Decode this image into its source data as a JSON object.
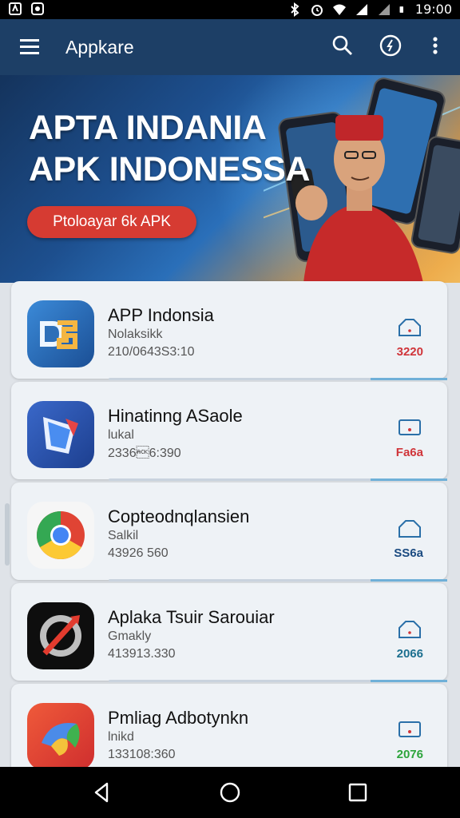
{
  "status_bar": {
    "time": "19:00",
    "icons": [
      "notification-icon",
      "camera-icon",
      "bluetooth-icon",
      "alarm-icon",
      "wifi-icon",
      "signal-icon",
      "signal-icon",
      "battery-icon"
    ]
  },
  "app_bar": {
    "title": "Appkare",
    "icons": [
      "menu-icon",
      "search-icon",
      "history-icon",
      "more-vert-icon"
    ]
  },
  "banner": {
    "headline_1": "APTA INDANIA",
    "headline_2": "APK INDONESSA",
    "cta_label": "Ptoloayar 6k APK"
  },
  "apps": [
    {
      "name": "APP Indonsia",
      "subtitle": "Nolaksikk",
      "meta": "210/0643S3:10",
      "count": "3220",
      "count_color": "#d0353a",
      "icon": "app-indonsia-icon"
    },
    {
      "name": "Hinatinng ASaole",
      "subtitle": "lukal",
      "meta": "2336\u00066:390",
      "count": "Fa6a",
      "count_color": "#d0353a",
      "icon": "hinatinng-asaole-icon"
    },
    {
      "name": "Copteodnqlansien",
      "subtitle": "Salkil",
      "meta": "43926 560",
      "count": "SS6a",
      "count_color": "#1a4a80",
      "icon": "chrome-icon"
    },
    {
      "name": "Aplaka Tsuir Sarouiar",
      "subtitle": "Gmakly",
      "meta": "413913.330",
      "count": "2066",
      "count_color": "#1c6f8f",
      "icon": "aplaka-icon"
    },
    {
      "name": "Pmliag Adbotynkn",
      "subtitle": "lnikd",
      "meta": "133108:360",
      "count": "2076",
      "count_color": "#2da43c",
      "icon": "pmliag-icon"
    }
  ],
  "nav_bar": {
    "icons": [
      "back-icon",
      "home-icon",
      "recents-icon"
    ]
  }
}
